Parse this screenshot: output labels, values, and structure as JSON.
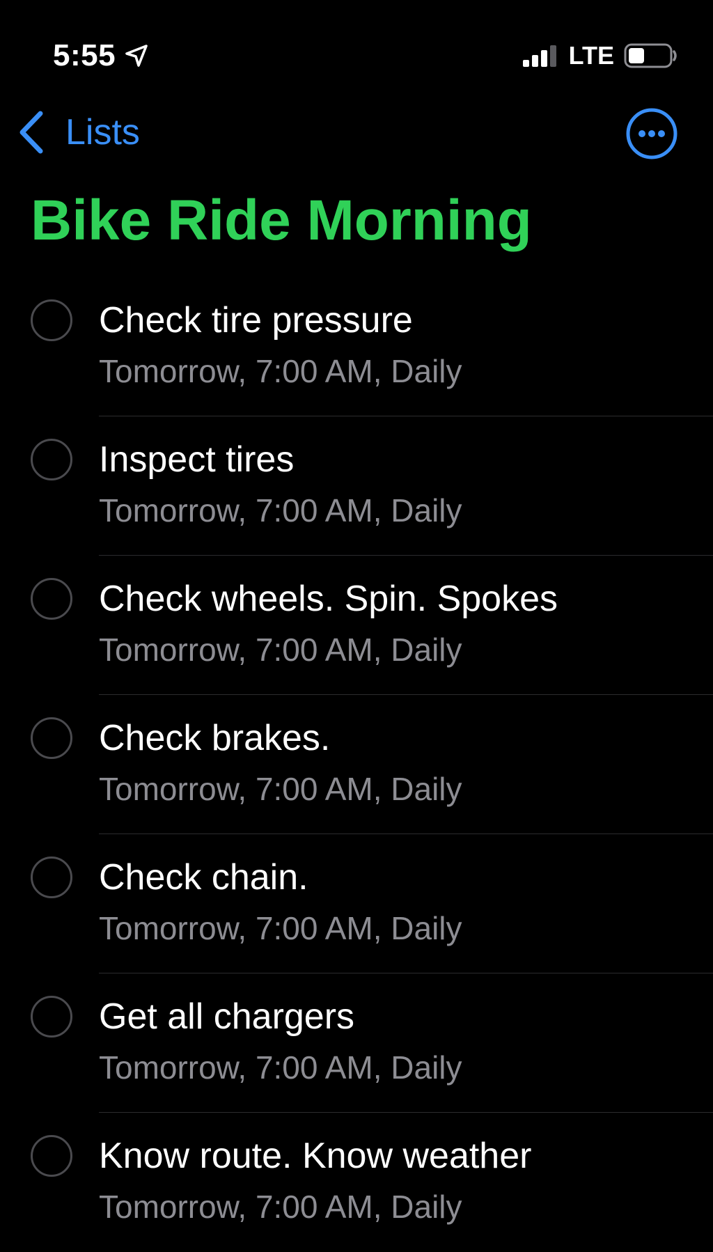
{
  "status_bar": {
    "time": "5:55",
    "network": "LTE",
    "location_icon": "location-arrow-icon",
    "signal_icon": "cellular-signal-icon",
    "battery_icon": "battery-icon"
  },
  "nav": {
    "back_label": "Lists",
    "back_icon": "chevron-left-icon",
    "more_icon": "ellipsis-circle-icon"
  },
  "list": {
    "title": "Bike Ride Morning",
    "title_color": "#30d158",
    "accent_color": "#3a8ff7",
    "reminders": [
      {
        "title": "Check tire pressure",
        "detail": "Tomorrow, 7:00 AM, Daily"
      },
      {
        "title": "Inspect tires",
        "detail": "Tomorrow, 7:00 AM, Daily"
      },
      {
        "title": "Check wheels. Spin. Spokes",
        "detail": "Tomorrow, 7:00 AM, Daily"
      },
      {
        "title": "Check brakes.",
        "detail": "Tomorrow, 7:00 AM, Daily"
      },
      {
        "title": "Check chain.",
        "detail": "Tomorrow, 7:00 AM, Daily"
      },
      {
        "title": "Get all chargers",
        "detail": "Tomorrow, 7:00 AM, Daily"
      },
      {
        "title": "Know route. Know weather",
        "detail": "Tomorrow, 7:00 AM, Daily"
      }
    ]
  }
}
